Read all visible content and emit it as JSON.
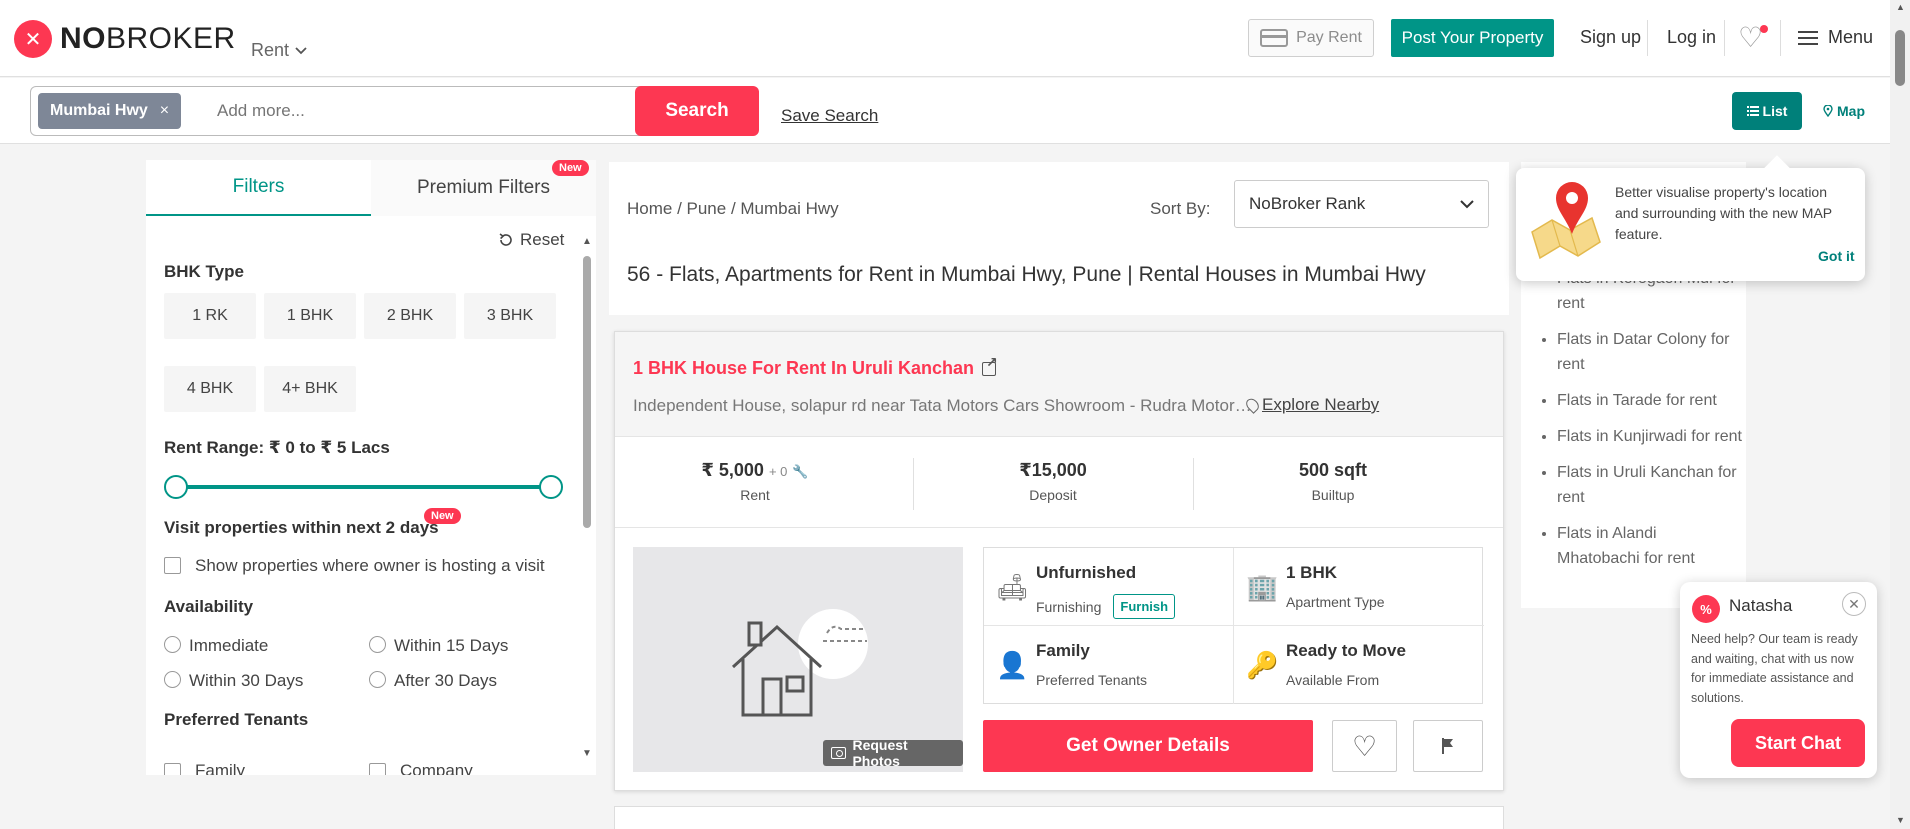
{
  "header": {
    "logo_mark": "✕",
    "logo_bold": "NO",
    "logo_rest": "BROKER",
    "rent_label": "Rent",
    "pay_rent": "Pay Rent",
    "post_property": "Post Your Property",
    "signup": "Sign up",
    "login": "Log in",
    "menu": "Menu"
  },
  "search": {
    "chip": "Mumbai Hwy",
    "placeholder": "Add more...",
    "button": "Search",
    "save_search": "Save Search",
    "list": "List",
    "map": "Map"
  },
  "filters": {
    "tab_filters": "Filters",
    "tab_premium": "Premium Filters",
    "new_badge": "New",
    "reset": "Reset",
    "bhk_label": "BHK Type",
    "bhk_options": [
      "1 RK",
      "1 BHK",
      "2 BHK",
      "3 BHK",
      "4 BHK",
      "4+ BHK"
    ],
    "rent_range": "Rent Range: ₹ 0 to ₹ 5 Lacs",
    "visit_label": "Visit properties within next 2 days",
    "visit_check": "Show properties where owner is hosting a visit",
    "availability_label": "Availability",
    "availability": [
      "Immediate",
      "Within 15 Days",
      "Within 30 Days",
      "After 30 Days"
    ],
    "tenants_label": "Preferred Tenants",
    "tenants": [
      "Family",
      "Company"
    ]
  },
  "results": {
    "breadcrumb": "Home  / Pune / Mumbai Hwy",
    "sort_label": "Sort By:",
    "sort_value": "NoBroker Rank",
    "title": "56 - Flats, Apartments for Rent in Mumbai Hwy, Pune | Rental Houses in Mumbai Hwy"
  },
  "property": {
    "title": "1 BHK House For Rent In Uruli Kanchan",
    "subtitle": "Independent House, solapur rd near Tata Motors Cars Showroom - Rudra Motors, Uruli Kanchan",
    "explore": "Explore Nearby",
    "rent_value": "₹ 5,000",
    "rent_extra": "+ 0",
    "rent_label": "Rent",
    "deposit_value": "₹15,000",
    "deposit_label": "Deposit",
    "builtup_value": "500 sqft",
    "builtup_label": "Builtup",
    "request_photos": "Request Photos",
    "furnishing_value": "Unfurnished",
    "furnishing_label": "Furnishing",
    "furnish_tag": "Furnish",
    "apt_type_value": "1 BHK",
    "apt_type_label": "Apartment Type",
    "tenants_value": "Family",
    "tenants_label": "Preferred Tenants",
    "available_value": "Ready to Move",
    "available_label": "Available From",
    "owner_button": "Get Owner Details"
  },
  "related_links": [
    "Flats in Koregaon Mul for rent",
    "Flats in Datar Colony for rent",
    "Flats in Tarade for rent",
    "Flats in Kunjirwadi for rent",
    "Flats in Uruli Kanchan for rent",
    "Flats in Alandi Mhatobachi for rent"
  ],
  "map_tip": {
    "text": "Better visualise property's location and surrounding with the new MAP feature.",
    "got_it": "Got it"
  },
  "chat": {
    "name": "Natasha",
    "message": "Need help? Our team is ready and waiting, chat with us now for immediate assistance and solutions.",
    "start": "Start Chat"
  },
  "colors": {
    "brand_red": "#fd3752",
    "brand_teal": "#009587",
    "toggle_teal": "#00807a"
  }
}
